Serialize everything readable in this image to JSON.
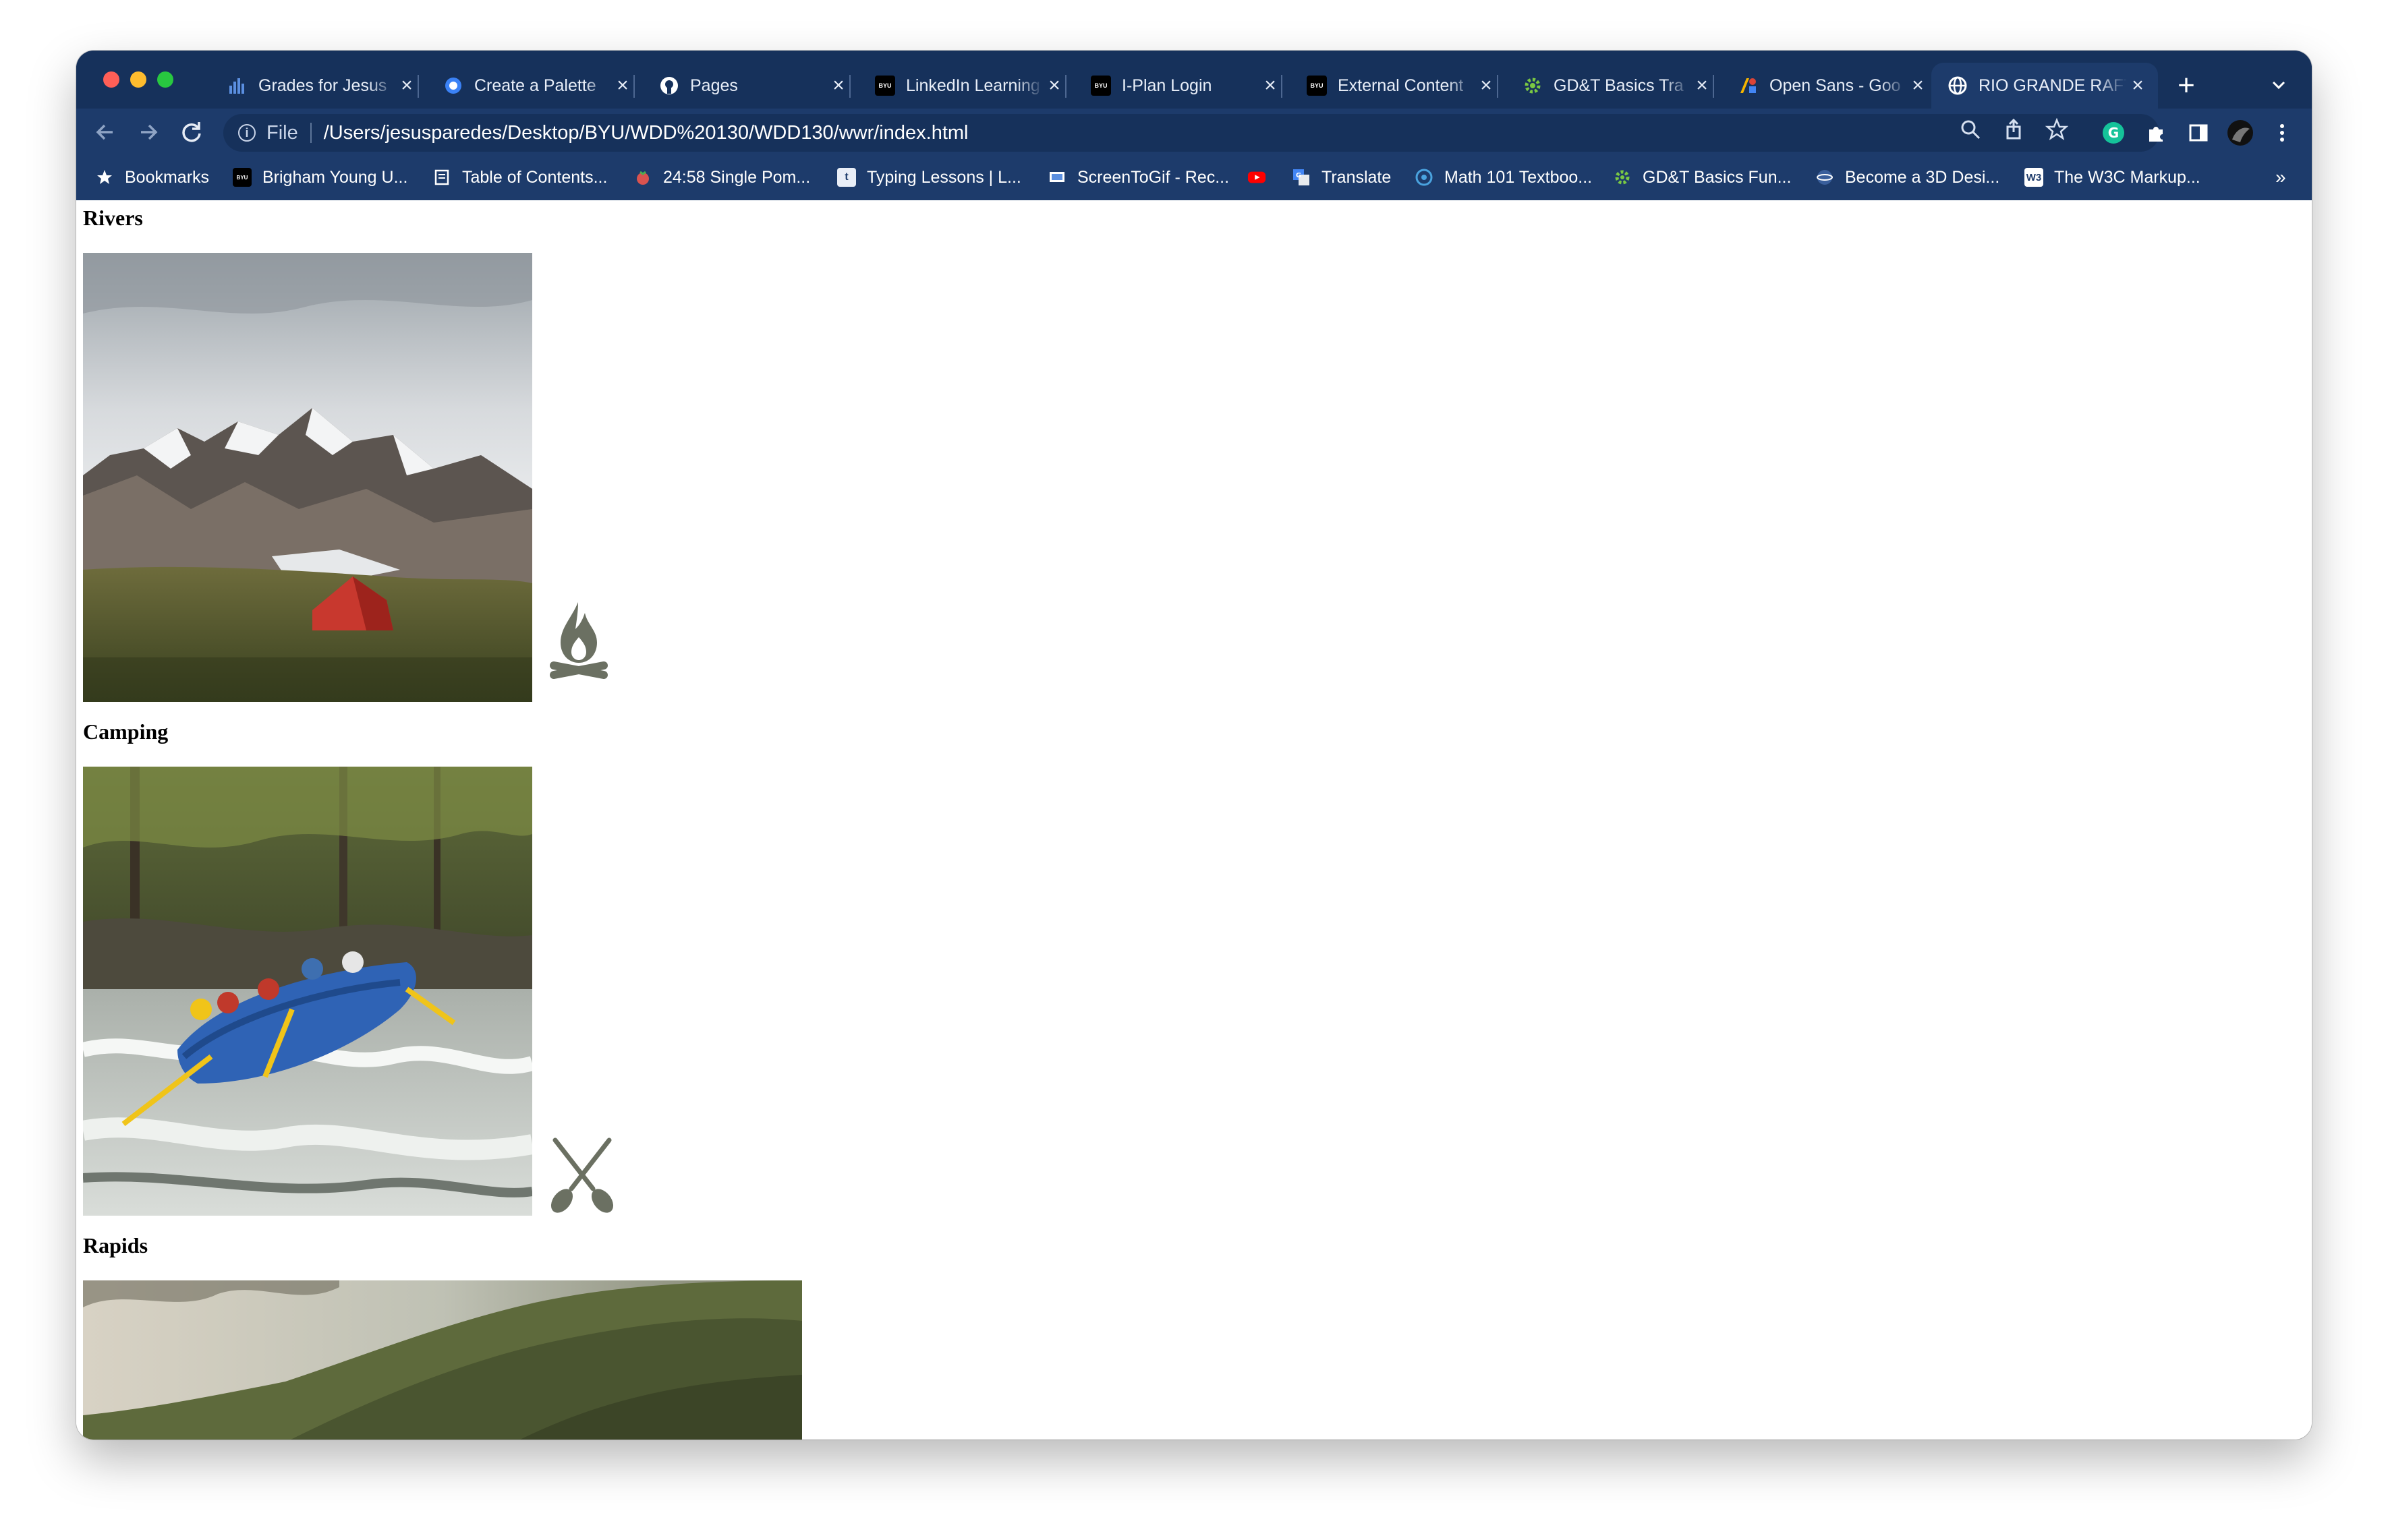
{
  "browser": {
    "tabs": [
      {
        "title": "Grades for Jesus",
        "active": false
      },
      {
        "title": "Create a Palette",
        "active": false
      },
      {
        "title": "Pages",
        "active": false
      },
      {
        "title": "LinkedIn Learning",
        "active": false
      },
      {
        "title": "I-Plan Login",
        "active": false
      },
      {
        "title": "External Content",
        "active": false
      },
      {
        "title": "GD&T Basics Tra",
        "active": false
      },
      {
        "title": "Open Sans - Goo",
        "active": false
      },
      {
        "title": "RIO GRANDE RAFTING",
        "active": true
      }
    ],
    "favicon_text": {
      "byu": "BYU"
    },
    "new_tab_label": "+",
    "address": {
      "scheme": "File",
      "url": "/Users/jesusparedes/Desktop/BYU/WDD%20130/WDD130/wwr/index.html"
    },
    "bookmarks": [
      {
        "label": "Bookmarks"
      },
      {
        "label": "Brigham Young U..."
      },
      {
        "label": "Table of Contents..."
      },
      {
        "label": "24:58 Single Pom..."
      },
      {
        "label": "Typing Lessons | L..."
      },
      {
        "label": "ScreenToGif - Rec..."
      },
      {
        "label": ""
      },
      {
        "label": "Translate"
      },
      {
        "label": "Math 101 Textboo..."
      },
      {
        "label": "GD&T Basics Fun..."
      },
      {
        "label": "Become a 3D Desi..."
      },
      {
        "label": "The W3C Markup..."
      }
    ],
    "bookmarks_overflow": "»",
    "colors": {
      "frame": "#16315b",
      "toolbar": "#1d3b6b"
    }
  },
  "page": {
    "sections": [
      {
        "heading": "Rivers",
        "image": "mountain-camp-photo",
        "icon": "campfire-icon"
      },
      {
        "heading": "Camping",
        "image": "rafting-photo",
        "icon": "crossed-paddles-icon"
      },
      {
        "heading": "Rapids",
        "image": "green-valley-photo"
      }
    ],
    "icon_color": "#6b7062"
  }
}
